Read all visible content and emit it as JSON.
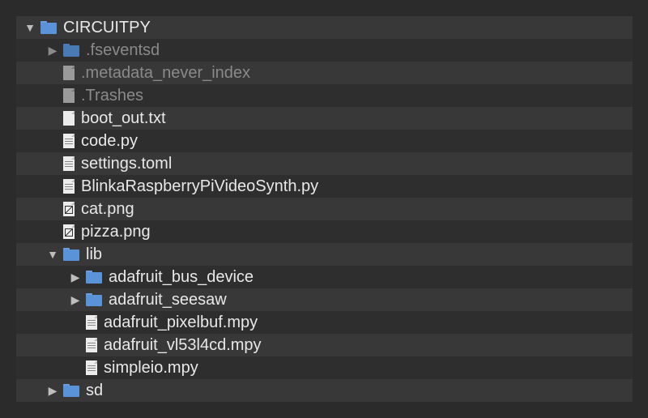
{
  "tree": {
    "root": {
      "label": "CIRCUITPY",
      "expanded_glyph": "▼"
    },
    "items": [
      {
        "label": ".fseventsd",
        "glyph": "▶"
      },
      {
        "label": ".metadata_never_index"
      },
      {
        "label": ".Trashes"
      },
      {
        "label": "boot_out.txt"
      },
      {
        "label": "code.py"
      },
      {
        "label": "settings.toml"
      },
      {
        "label": "BlinkaRaspberryPiVideoSynth.py"
      },
      {
        "label": "cat.png"
      },
      {
        "label": "pizza.png"
      },
      {
        "label": "lib",
        "glyph": "▼"
      },
      {
        "label": "adafruit_bus_device",
        "glyph": "▶"
      },
      {
        "label": "adafruit_seesaw",
        "glyph": "▶"
      },
      {
        "label": "adafruit_pixelbuf.mpy"
      },
      {
        "label": "adafruit_vl53l4cd.mpy"
      },
      {
        "label": "simpleio.mpy"
      },
      {
        "label": "sd",
        "glyph": "▶"
      }
    ]
  },
  "colors": {
    "background": "#2b2b2b",
    "panel": "#2e2e2e",
    "row_alt": "#383838",
    "folder": "#5b93d8",
    "text": "#e8e8e8",
    "text_dim": "#8a8a8a"
  }
}
